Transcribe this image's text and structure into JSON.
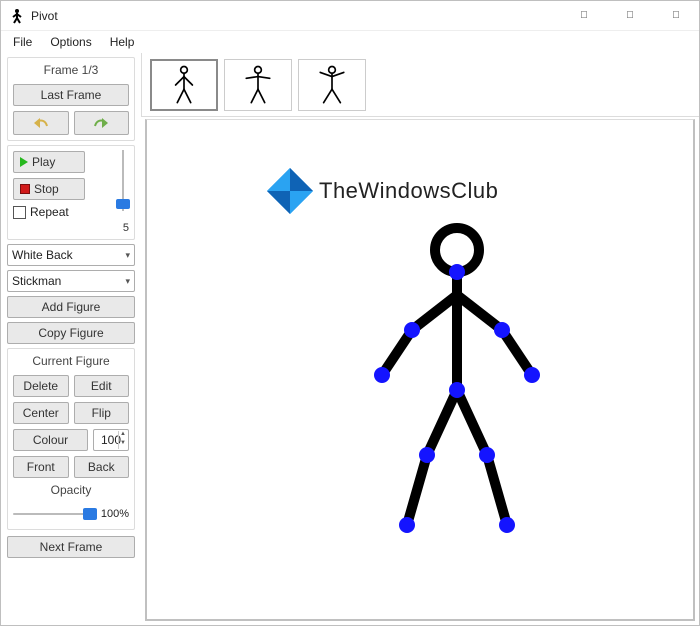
{
  "window": {
    "title": "Pivot"
  },
  "menubar": {
    "items": [
      "File",
      "Options",
      "Help"
    ]
  },
  "sidebar": {
    "frame_label": "Frame 1/3",
    "last_frame": "Last Frame",
    "play": "Play",
    "stop": "Stop",
    "repeat": "Repeat",
    "speed_value": "5",
    "bg_combo": "White Back",
    "figure_combo": "Stickman",
    "add_figure": "Add Figure",
    "copy_figure": "Copy Figure",
    "current_figure": "Current Figure",
    "delete": "Delete",
    "edit": "Edit",
    "center": "Center",
    "flip": "Flip",
    "colour": "Colour",
    "scale": "100",
    "front": "Front",
    "back": "Back",
    "opacity": "Opacity",
    "opacity_value": "100%",
    "next_frame": "Next Frame"
  },
  "watermark": {
    "text": "TheWindowsClub"
  },
  "colors": {
    "joint": "#1414ff",
    "bone": "#000",
    "logo1": "#1d85e8",
    "logo2": "#2aa3f2"
  }
}
